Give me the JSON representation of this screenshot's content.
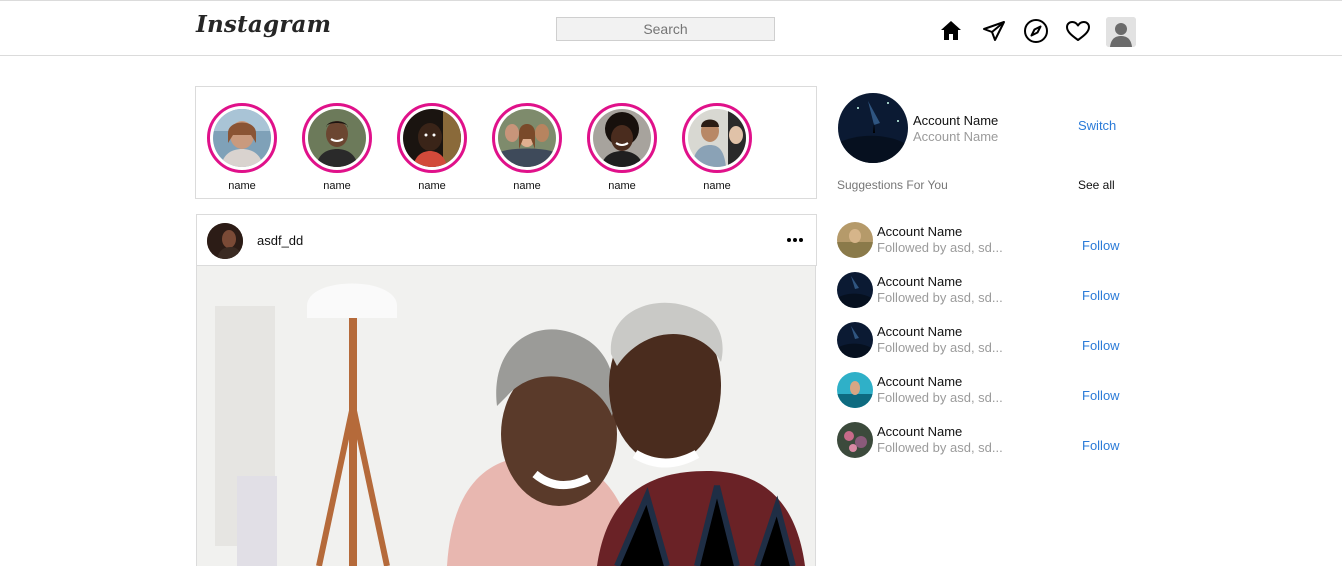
{
  "header": {
    "logo": "Instagram",
    "search_placeholder": "Search",
    "icons": [
      "home-icon",
      "direct-message-icon",
      "explore-icon",
      "activity-heart-icon",
      "profile-avatar"
    ]
  },
  "stories": [
    {
      "name": "name"
    },
    {
      "name": "name"
    },
    {
      "name": "name"
    },
    {
      "name": "name"
    },
    {
      "name": "name"
    },
    {
      "name": "name"
    }
  ],
  "post": {
    "username": "asdf_dd",
    "more_icon": "more-options-icon"
  },
  "sidebar": {
    "account_name": "Account Name",
    "account_sub": "Account Name",
    "switch_label": "Switch",
    "suggestions_title": "Suggestions For You",
    "see_all_label": "See all",
    "suggestions": [
      {
        "name": "Account Name",
        "followed_by": "Followed by asd, sd...",
        "action": "Follow"
      },
      {
        "name": "Account Name",
        "followed_by": "Followed by asd, sd...",
        "action": "Follow"
      },
      {
        "name": "Account Name",
        "followed_by": "Followed by asd, sd...",
        "action": "Follow"
      },
      {
        "name": "Account Name",
        "followed_by": "Followed by asd, sd...",
        "action": "Follow"
      },
      {
        "name": "Account Name",
        "followed_by": "Followed by asd, sd...",
        "action": "Follow"
      }
    ]
  },
  "colors": {
    "story_ring": "#e0118a",
    "link": "#2b7bd8",
    "muted": "#9b9b9b",
    "border": "#dbdbdb"
  }
}
